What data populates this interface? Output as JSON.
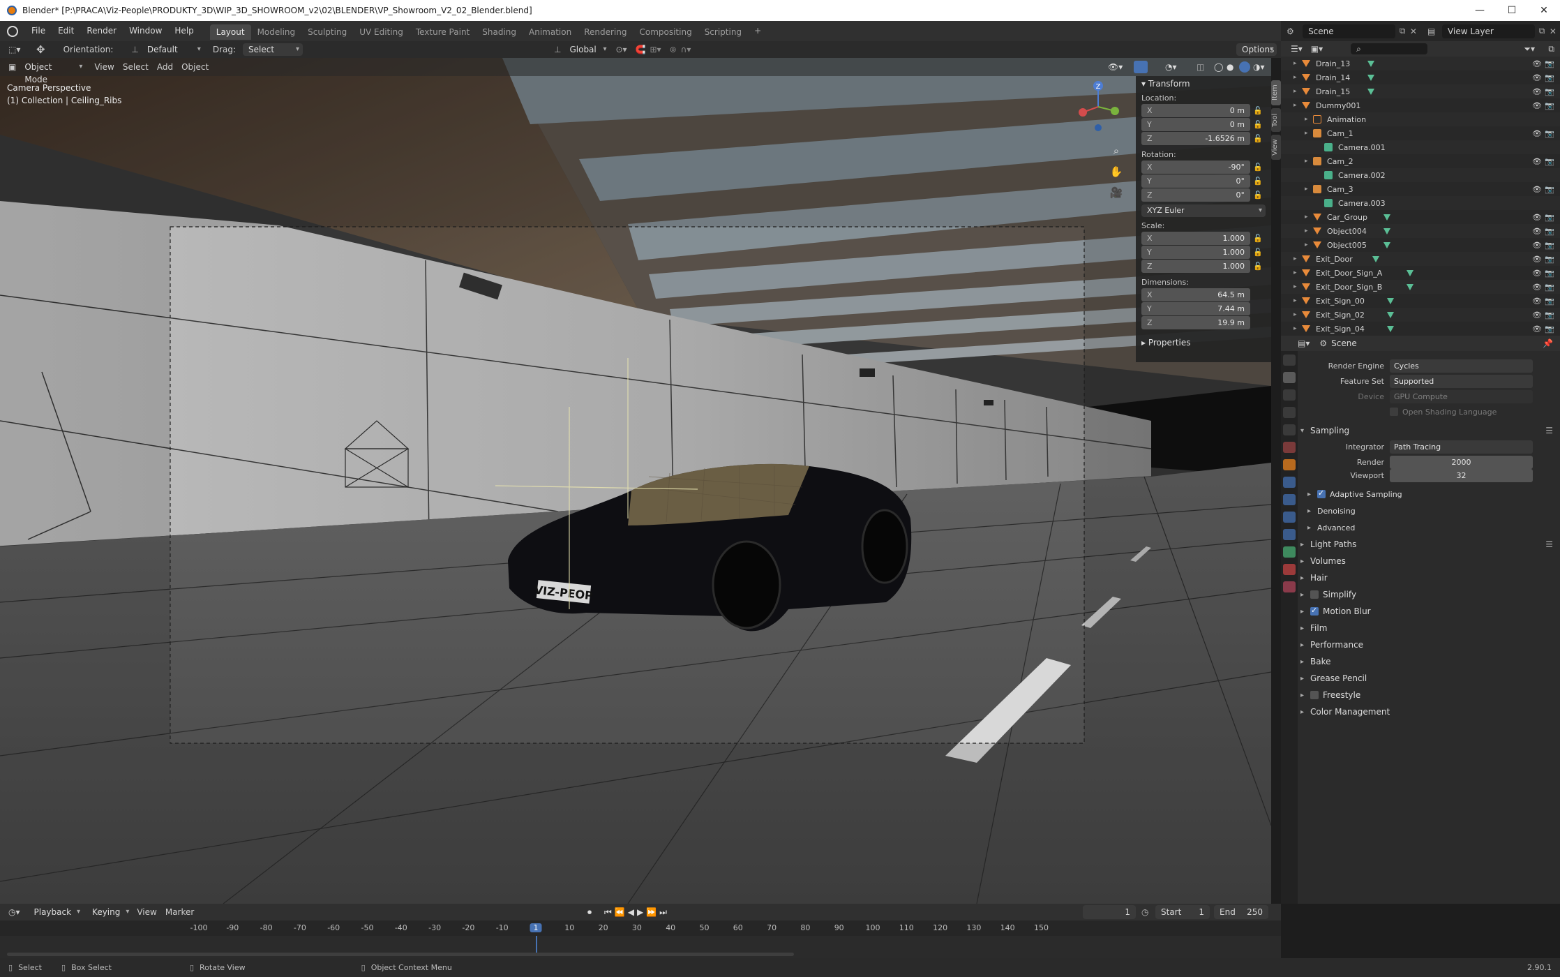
{
  "title": "Blender* [P:\\PRACA\\Viz-People\\PRODUKTY_3D\\WIP_3D_SHOWROOM_v2\\02\\BLENDER\\VP_Showroom_V2_02_Blender.blend]",
  "menu": [
    "File",
    "Edit",
    "Render",
    "Window",
    "Help"
  ],
  "workspaces": [
    "Layout",
    "Modeling",
    "Sculpting",
    "UV Editing",
    "Texture Paint",
    "Shading",
    "Animation",
    "Rendering",
    "Compositing",
    "Scripting"
  ],
  "scene_field": "Scene",
  "viewlayer_field": "View Layer",
  "toolbar": {
    "orientation_label": "Orientation:",
    "orientation_value": "Default",
    "drag_label": "Drag:",
    "drag_value": "Select Box",
    "transform_space": "Global",
    "options": "Options"
  },
  "viewport_header": {
    "mode": "Object Mode",
    "items": [
      "View",
      "Select",
      "Add",
      "Object"
    ]
  },
  "viewport_info": {
    "line1": "Camera Perspective",
    "line2": "(1) Collection | Ceiling_Ribs"
  },
  "license_plate": "VIZ-PEOP",
  "npanel": {
    "header": "Transform",
    "location_label": "Location:",
    "location": [
      {
        "axis": "X",
        "value": "0 m"
      },
      {
        "axis": "Y",
        "value": "0 m"
      },
      {
        "axis": "Z",
        "value": "-1.6526 m"
      }
    ],
    "rotation_label": "Rotation:",
    "rotation": [
      {
        "axis": "X",
        "value": "-90°"
      },
      {
        "axis": "Y",
        "value": "0°"
      },
      {
        "axis": "Z",
        "value": "0°"
      }
    ],
    "rotation_mode": "XYZ Euler",
    "scale_label": "Scale:",
    "scale": [
      {
        "axis": "X",
        "value": "1.000"
      },
      {
        "axis": "Y",
        "value": "1.000"
      },
      {
        "axis": "Z",
        "value": "1.000"
      }
    ],
    "dimensions_label": "Dimensions:",
    "dimensions": [
      {
        "axis": "X",
        "value": "64.5 m"
      },
      {
        "axis": "Y",
        "value": "7.44 m"
      },
      {
        "axis": "Z",
        "value": "19.9 m"
      }
    ],
    "properties": "Properties",
    "tabs": [
      "Item",
      "Tool",
      "View"
    ]
  },
  "outliner": [
    {
      "name": "Drain_13",
      "type": "object",
      "indent": 0
    },
    {
      "name": "Drain_14",
      "type": "object",
      "indent": 0
    },
    {
      "name": "Drain_15",
      "type": "object",
      "indent": 0
    },
    {
      "name": "Dummy001",
      "type": "object",
      "indent": 0
    },
    {
      "name": "Animation",
      "type": "anim",
      "indent": 1
    },
    {
      "name": "Cam_1",
      "type": "camera",
      "indent": 1
    },
    {
      "name": "Camera.001",
      "type": "camdata",
      "indent": 2
    },
    {
      "name": "Cam_2",
      "type": "camera",
      "indent": 1
    },
    {
      "name": "Camera.002",
      "type": "camdata",
      "indent": 2
    },
    {
      "name": "Cam_3",
      "type": "camera",
      "indent": 1
    },
    {
      "name": "Camera.003",
      "type": "camdata",
      "indent": 2
    },
    {
      "name": "Car_Group",
      "type": "object",
      "indent": 1
    },
    {
      "name": "Object004",
      "type": "object",
      "indent": 1
    },
    {
      "name": "Object005",
      "type": "object",
      "indent": 1
    },
    {
      "name": "Exit_Door",
      "type": "object",
      "indent": 0
    },
    {
      "name": "Exit_Door_Sign_A",
      "type": "object",
      "indent": 0
    },
    {
      "name": "Exit_Door_Sign_B",
      "type": "object",
      "indent": 0
    },
    {
      "name": "Exit_Sign_00",
      "type": "object",
      "indent": 0
    },
    {
      "name": "Exit_Sign_02",
      "type": "object",
      "indent": 0
    },
    {
      "name": "Exit_Sign_04",
      "type": "object",
      "indent": 0
    }
  ],
  "properties": {
    "context": "Scene",
    "render_engine_label": "Render Engine",
    "render_engine": "Cycles",
    "feature_set_label": "Feature Set",
    "feature_set": "Supported",
    "device_label": "Device",
    "device": "GPU Compute",
    "osl": "Open Shading Language",
    "sampling": "Sampling",
    "integrator_label": "Integrator",
    "integrator": "Path Tracing",
    "render_label": "Render",
    "render_samples": "2000",
    "viewport_label": "Viewport",
    "viewport_samples": "32",
    "adaptive_sampling": "Adaptive Sampling",
    "denoising": "Denoising",
    "advanced": "Advanced",
    "sections": [
      {
        "label": "Light Paths",
        "checkbox": "none"
      },
      {
        "label": "Volumes",
        "checkbox": "none"
      },
      {
        "label": "Hair",
        "checkbox": "none"
      },
      {
        "label": "Simplify",
        "checkbox": "off"
      },
      {
        "label": "Motion Blur",
        "checkbox": "on"
      },
      {
        "label": "Film",
        "checkbox": "none"
      },
      {
        "label": "Performance",
        "checkbox": "none"
      },
      {
        "label": "Bake",
        "checkbox": "none"
      },
      {
        "label": "Grease Pencil",
        "checkbox": "none"
      },
      {
        "label": "Freestyle",
        "checkbox": "off"
      },
      {
        "label": "Color Management",
        "checkbox": "none"
      }
    ]
  },
  "timeline": {
    "menus": [
      "Playback",
      "Keying",
      "View",
      "Marker"
    ],
    "current_frame": "1",
    "start_label": "Start",
    "start": "1",
    "end_label": "End",
    "end": "250",
    "ticks": [
      "-100",
      "-90",
      "-80",
      "-70",
      "-60",
      "-50",
      "-40",
      "-30",
      "-20",
      "-10",
      "1",
      "10",
      "20",
      "30",
      "40",
      "50",
      "60",
      "70",
      "80",
      "90",
      "100",
      "110",
      "120",
      "130",
      "140",
      "150"
    ]
  },
  "status": {
    "select": "Select",
    "box_select": "Box Select",
    "rotate": "Rotate View",
    "context_menu": "Object Context Menu",
    "version": "2.90.1"
  }
}
